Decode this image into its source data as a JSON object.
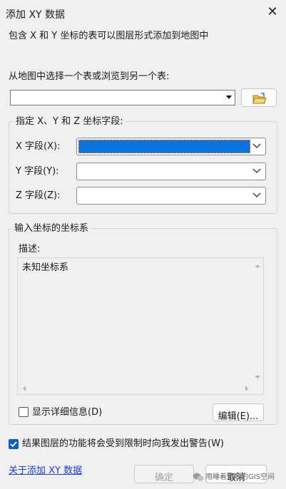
{
  "window": {
    "title": "添加 XY 数据"
  },
  "description_line": "包含 X 和 Y 坐标的表可以图层形式添加到地图中",
  "table_select": {
    "label": "从地图中选择一个表或浏览到另一个表:",
    "value": ""
  },
  "fields_group": {
    "legend": "指定 X、Y 和 Z 坐标字段:",
    "x_label": "X 字段(X):",
    "y_label": "Y 字段(Y):",
    "z_label": "Z 字段(Z):",
    "x_value": "",
    "y_value": "",
    "z_value": ""
  },
  "coord_group": {
    "legend": "输入坐标的坐标系",
    "desc_label": "描述:",
    "desc_text": "未知坐标系",
    "show_details_label": "显示详细信息(D)",
    "show_details_checked": false,
    "edit_label": "编辑(E)..."
  },
  "warn": {
    "label": "结果图层的功能将会受到限制时向我发出警告(W)",
    "checked": true
  },
  "footer": {
    "help_link": "关于添加 XY 数据",
    "ok_label": "确定",
    "cancel_label": "取消",
    "watermark": "用睡着懒散的GIS空间"
  },
  "colors": {
    "accent": "#0a74da",
    "checkbox_on": "#0a5fc7",
    "link": "#1c3fd0"
  },
  "icons": [
    "close-icon",
    "dropdown-arrow-icon",
    "open-folder-icon",
    "chevron-down-icon",
    "checkmark-icon",
    "wechat-icon"
  ]
}
